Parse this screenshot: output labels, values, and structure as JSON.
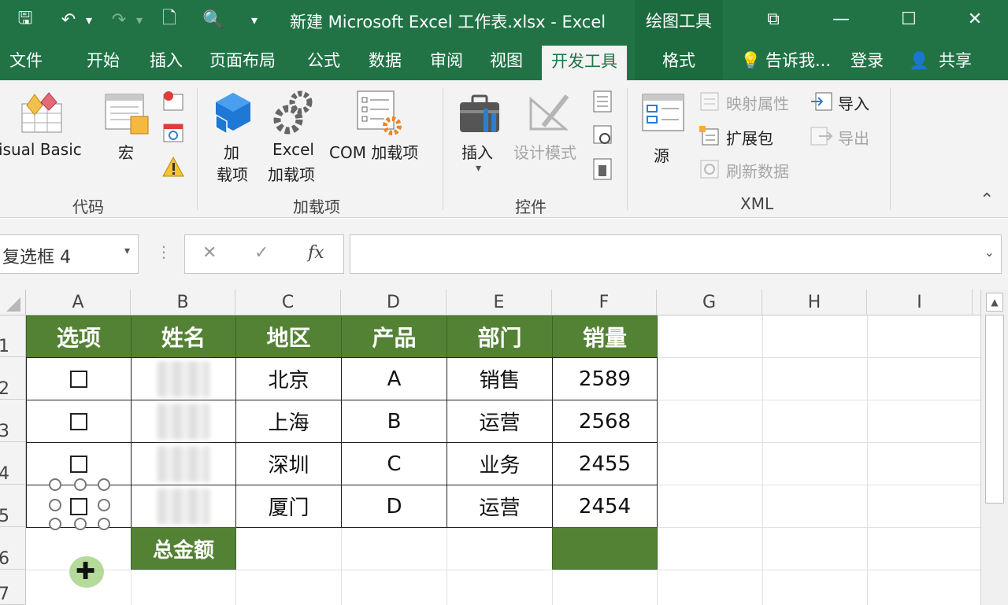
{
  "app": {
    "title": "新建 Microsoft Excel 工作表.xlsx - Excel",
    "context_tab": "绘图工具",
    "quick_access": {
      "save": "🖫",
      "undo": "↶",
      "undo_dd": "▾",
      "redo": "↷",
      "redo_dd": "▾",
      "new": "🗋",
      "preview": "🔍",
      "customize": "▾"
    },
    "window": {
      "restore_ribbon": "⧉",
      "minimize": "—",
      "maximize": "☐",
      "close": "✕"
    }
  },
  "tabs": {
    "file": "文件",
    "home": "开始",
    "insert": "插入",
    "page_layout": "页面布局",
    "formulas": "公式",
    "data": "数据",
    "review": "审阅",
    "view": "视图",
    "developer": "开发工具",
    "format": "格式",
    "tell_me": "告诉我...",
    "login": "登录",
    "share": "共享",
    "tell_me_icon": "💡",
    "share_icon": "👤"
  },
  "ribbon": {
    "code": {
      "label": "代码",
      "visual_basic": "isual Basic",
      "macro": "宏"
    },
    "addins": {
      "label": "加载项",
      "addin_line1": "加",
      "addin_line2": "载项",
      "excel_addin_line1": "Excel",
      "excel_addin_line2": "加载项",
      "com_addin": "COM 加载项"
    },
    "controls": {
      "label": "控件",
      "insert": "插入",
      "insert_dd": "▾",
      "design_mode": "设计模式"
    },
    "xml": {
      "label": "XML",
      "source": "源",
      "map_props": "映射属性",
      "expansion": "扩展包",
      "refresh": "刷新数据",
      "import": "导入",
      "export": "导出"
    },
    "collapse": "⌃"
  },
  "formula_bar": {
    "name_box": "复选框 4",
    "name_dd": "▾",
    "dots": "⋮",
    "cancel": "✕",
    "enter": "✓",
    "fx": "fx",
    "value": "",
    "expand": "⌄"
  },
  "sheet": {
    "columns": [
      "A",
      "B",
      "C",
      "D",
      "E",
      "F",
      "G",
      "H",
      "I"
    ],
    "rows": [
      "1",
      "2",
      "3",
      "4",
      "5",
      "6",
      "7"
    ],
    "header": [
      "选项",
      "姓名",
      "地区",
      "产品",
      "部门",
      "销量"
    ],
    "data": [
      {
        "region": "北京",
        "product": "A",
        "dept": "销售",
        "sales": "2589"
      },
      {
        "region": "上海",
        "product": "B",
        "dept": "运营",
        "sales": "2568"
      },
      {
        "region": "深圳",
        "product": "C",
        "dept": "业务",
        "sales": "2455"
      },
      {
        "region": "厦门",
        "product": "D",
        "dept": "运营",
        "sales": "2454"
      }
    ],
    "total_label": "总金额",
    "total_value": ""
  },
  "colors": {
    "excel_green": "#217346",
    "table_header": "#548235"
  }
}
